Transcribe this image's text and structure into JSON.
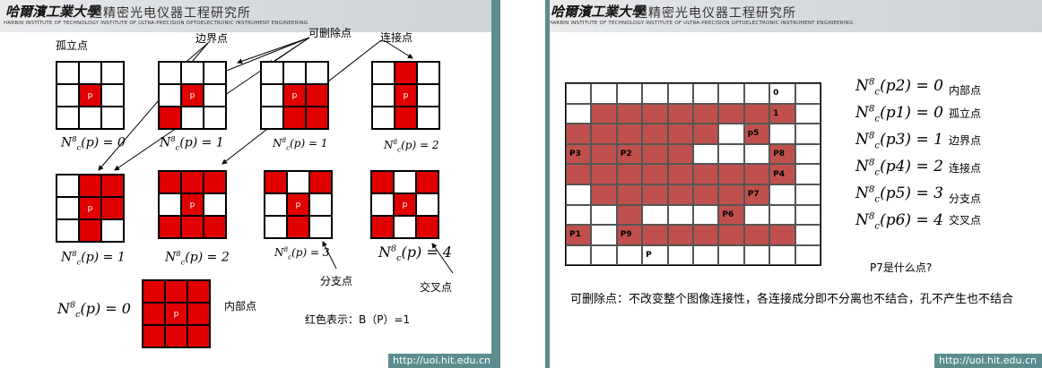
{
  "header": {
    "logo": "哈爾濱工業大學",
    "institute": "超精密光电仪器工程研究所",
    "institute_en": "HARBIN INSTITUTE OF TECHNOLOGY  INSTITUTE OF ULTRA-PRECISION OPTOELECTRONIC INSTRUMENT ENGINEERING"
  },
  "footer": {
    "url": "http://uoi.hit.edu.cn"
  },
  "left": {
    "labels": {
      "isolated": "孤立点",
      "boundary": "边界点",
      "deletable": "可删除点",
      "connecting": "连接点",
      "branch": "分支点",
      "cross": "交叉点",
      "interior": "内部点",
      "legend": "红色表示：B（P）=1"
    },
    "equations": [
      {
        "lhs": "N",
        "sup": "8",
        "sub": "c",
        "arg": "(p) = 0"
      },
      {
        "lhs": "N",
        "sup": "8",
        "sub": "c",
        "arg": "(p) = 1"
      },
      {
        "lhs": "N",
        "sup": "8",
        "sub": "c",
        "arg": "(p) = 1"
      },
      {
        "lhs": "N",
        "sup": "8",
        "sub": "c",
        "arg": "(p) = 2"
      },
      {
        "lhs": "N",
        "sup": "8",
        "sub": "c",
        "arg": "(p) = 1"
      },
      {
        "lhs": "N",
        "sup": "8",
        "sub": "c",
        "arg": "(p) = 2"
      },
      {
        "lhs": "N",
        "sup": "8",
        "sub": "c",
        "arg": "(p) = 3"
      },
      {
        "lhs": "N",
        "sup": "8",
        "sub": "c",
        "arg": "(p) = 4"
      },
      {
        "lhs": "N",
        "sup": "8",
        "sub": "c",
        "arg": "(p) = 0"
      }
    ],
    "center_label": "p"
  },
  "right": {
    "cell_labels": {
      "c0": "0",
      "c1": "1",
      "p5": "p5",
      "p3": "P3",
      "p2": "P2",
      "p8": "P8",
      "p4": "P4",
      "p7": "P7",
      "p6": "P6",
      "p1": "P1",
      "p9": "P9",
      "p": "P"
    },
    "legend": [
      {
        "arg": "(p2) = 0",
        "label": "内部点"
      },
      {
        "arg": "(p1) = 0",
        "label": "孤立点"
      },
      {
        "arg": "(p3) = 1",
        "label": "边界点"
      },
      {
        "arg": "(p4) = 2",
        "label": "连接点"
      },
      {
        "arg": "(p5) = 3",
        "label": "分支点"
      },
      {
        "arg": "(p6) = 4",
        "label": "交叉点"
      }
    ],
    "question": "P7是什么点?",
    "definition": "可删除点：不改变整个图像连接性，各连接成分即不分离也不结合，孔不产生也不结合"
  }
}
